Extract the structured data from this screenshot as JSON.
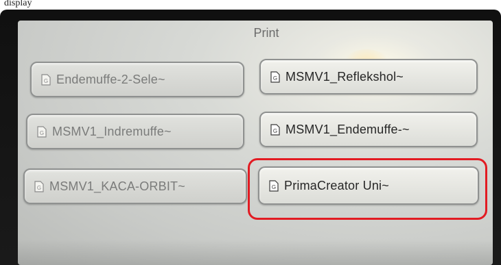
{
  "caption": "display",
  "screen": {
    "title": "Print"
  },
  "files": {
    "left": [
      {
        "label": "Endemuffe-2-Sele~",
        "icon": "document-g-icon"
      },
      {
        "label": "MSMV1_Indremuffe~",
        "icon": "document-g-icon"
      },
      {
        "label": "MSMV1_KACA-ORBIT~",
        "icon": "document-g-icon"
      }
    ],
    "right": [
      {
        "label": "MSMV1_Reflekshol~",
        "icon": "document-g-icon"
      },
      {
        "label": "MSMV1_Endemuffe-~",
        "icon": "document-g-icon"
      },
      {
        "label": "PrimaCreator Uni~",
        "icon": "document-g-icon",
        "highlighted": true
      }
    ]
  },
  "colors": {
    "highlight": "#e21b22"
  }
}
